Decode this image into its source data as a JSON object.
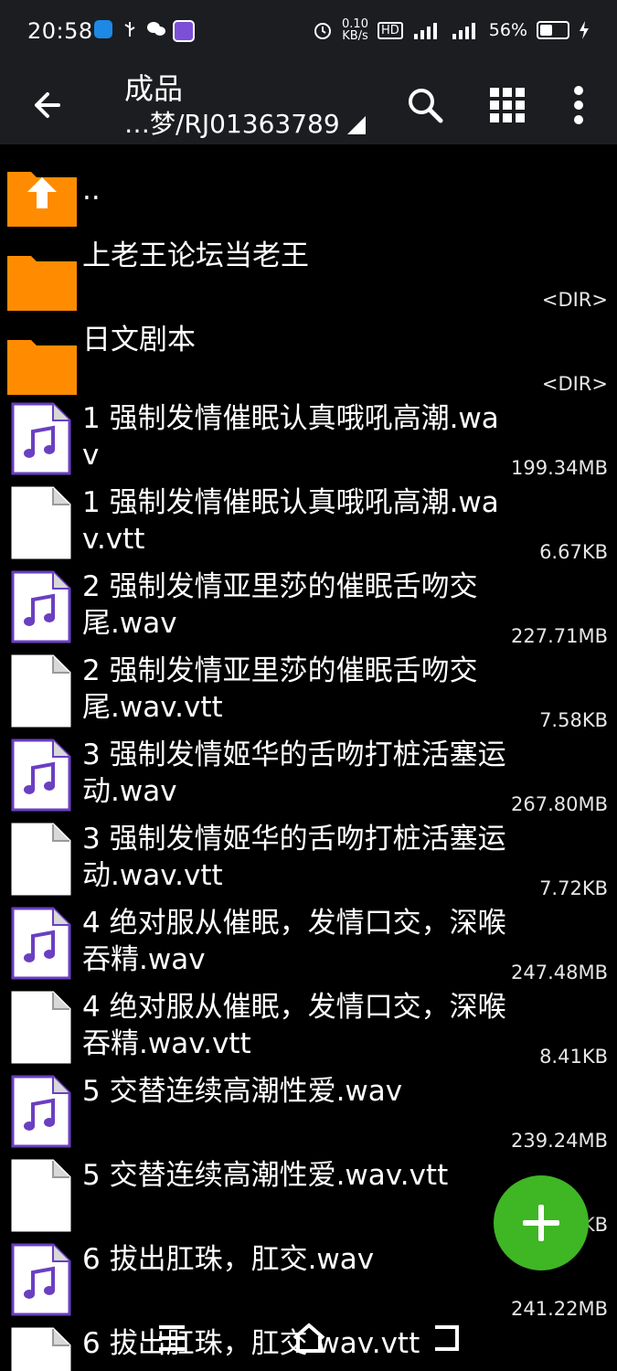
{
  "status": {
    "time": "20:58",
    "net_speed": "0.10\nKB/s",
    "battery": "56%",
    "battery_level": 0.56
  },
  "toolbar": {
    "title": "成品",
    "path": "…梦/RJ01363789"
  },
  "files": [
    {
      "name": "..",
      "meta": "",
      "type": "parent"
    },
    {
      "name": "上老王论坛当老王",
      "meta": "<DIR>",
      "type": "folder"
    },
    {
      "name": "日文剧本",
      "meta": "<DIR>",
      "type": "folder"
    },
    {
      "name": "1 强制发情催眠认真哦吼高潮.wav",
      "meta": "199.34MB",
      "type": "audio"
    },
    {
      "name": "1 强制发情催眠认真哦吼高潮.wav.vtt",
      "meta": "6.67KB",
      "type": "file"
    },
    {
      "name": "2 强制发情亚里莎的催眠舌吻交尾.wav",
      "meta": "227.71MB",
      "type": "audio"
    },
    {
      "name": "2 强制发情亚里莎的催眠舌吻交尾.wav.vtt",
      "meta": "7.58KB",
      "type": "file"
    },
    {
      "name": "3 强制发情姬华的舌吻打桩活塞运动.wav",
      "meta": "267.80MB",
      "type": "audio"
    },
    {
      "name": "3 强制发情姬华的舌吻打桩活塞运动.wav.vtt",
      "meta": "7.72KB",
      "type": "file"
    },
    {
      "name": "4 绝对服从催眠，发情口交，深喉吞精.wav",
      "meta": "247.48MB",
      "type": "audio"
    },
    {
      "name": "4 绝对服从催眠，发情口交，深喉吞精.wav.vtt",
      "meta": "8.41KB",
      "type": "file"
    },
    {
      "name": "5 交替连续高潮性爱.wav",
      "meta": "239.24MB",
      "type": "audio"
    },
    {
      "name": "5 交替连续高潮性爱.wav.vtt",
      "meta": "KB",
      "type": "file"
    },
    {
      "name": "6 拔出肛珠，肛交.wav",
      "meta": "241.22MB",
      "type": "audio"
    },
    {
      "name": "6 拔出肛珠，肛交.wav.vtt",
      "meta": "",
      "type": "file"
    }
  ],
  "colors": {
    "folder": "#ff8c00",
    "audio_accent": "#6a3fc2",
    "fab": "#3fb624",
    "toolbar": "#1b1d20"
  }
}
